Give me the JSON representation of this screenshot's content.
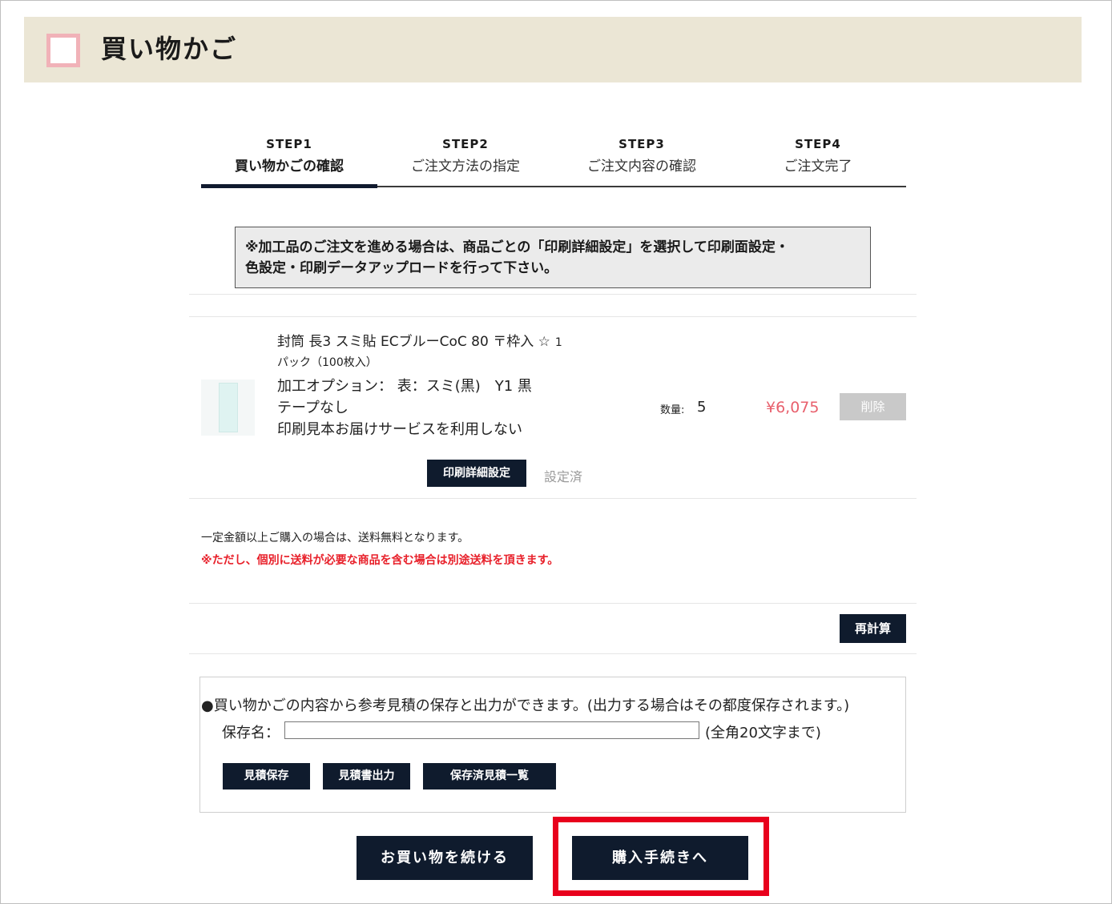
{
  "header": {
    "title": "買い物かご"
  },
  "steps": [
    {
      "num": "STEP1",
      "label": "買い物かごの確認",
      "active": true
    },
    {
      "num": "STEP2",
      "label": "ご注文方法の指定"
    },
    {
      "num": "STEP3",
      "label": "ご注文内容の確認"
    },
    {
      "num": "STEP4",
      "label": "ご注文完了"
    }
  ],
  "notice": {
    "line1": "※加工品のご注文を進める場合は、商品ごとの「印刷詳細設定」を選択して印刷面設定・",
    "line2": "色設定・印刷データアップロードを行って下さい。"
  },
  "product": {
    "name": "封筒 長3 スミ貼 ECブルーCoC 80 〒枠入 ☆",
    "pack_count": "1",
    "pack": "パック（100枚入）",
    "options": [
      "加工オプション：  表：スミ(黒)　Y1 黒",
      " テープなし",
      " 印刷見本お届けサービスを利用しない"
    ],
    "qty_label": "数量:",
    "qty": "5",
    "price": "¥6,075",
    "delete_label": "削除",
    "print_settings_label": "印刷詳細設定",
    "settings_status": "設定済"
  },
  "shipping": {
    "note": "一定金額以上ご購入の場合は、送料無料となります。",
    "warning": "※ただし、個別に送料が必要な商品を含む場合は別途送料を頂きます。"
  },
  "recalc_label": "再計算",
  "estimate": {
    "text": "●買い物かごの内容から参考見積の保存と出力ができます。(出力する場合はその都度保存されます。)",
    "save_name_label": "保存名：",
    "save_name_value": "",
    "save_hint": "(全角20文字まで)",
    "buttons": [
      "見積保存",
      "見積書出力",
      "保存済見積一覧"
    ]
  },
  "footer": {
    "continue_label": "お買い物を続ける",
    "checkout_label": "購入手続きへ"
  },
  "colors": {
    "header_bg": "#ebe6d5",
    "dark_button": "#0f1b2d",
    "price": "#e8606d",
    "warning": "#e8202a",
    "highlight": "#e8001c"
  }
}
